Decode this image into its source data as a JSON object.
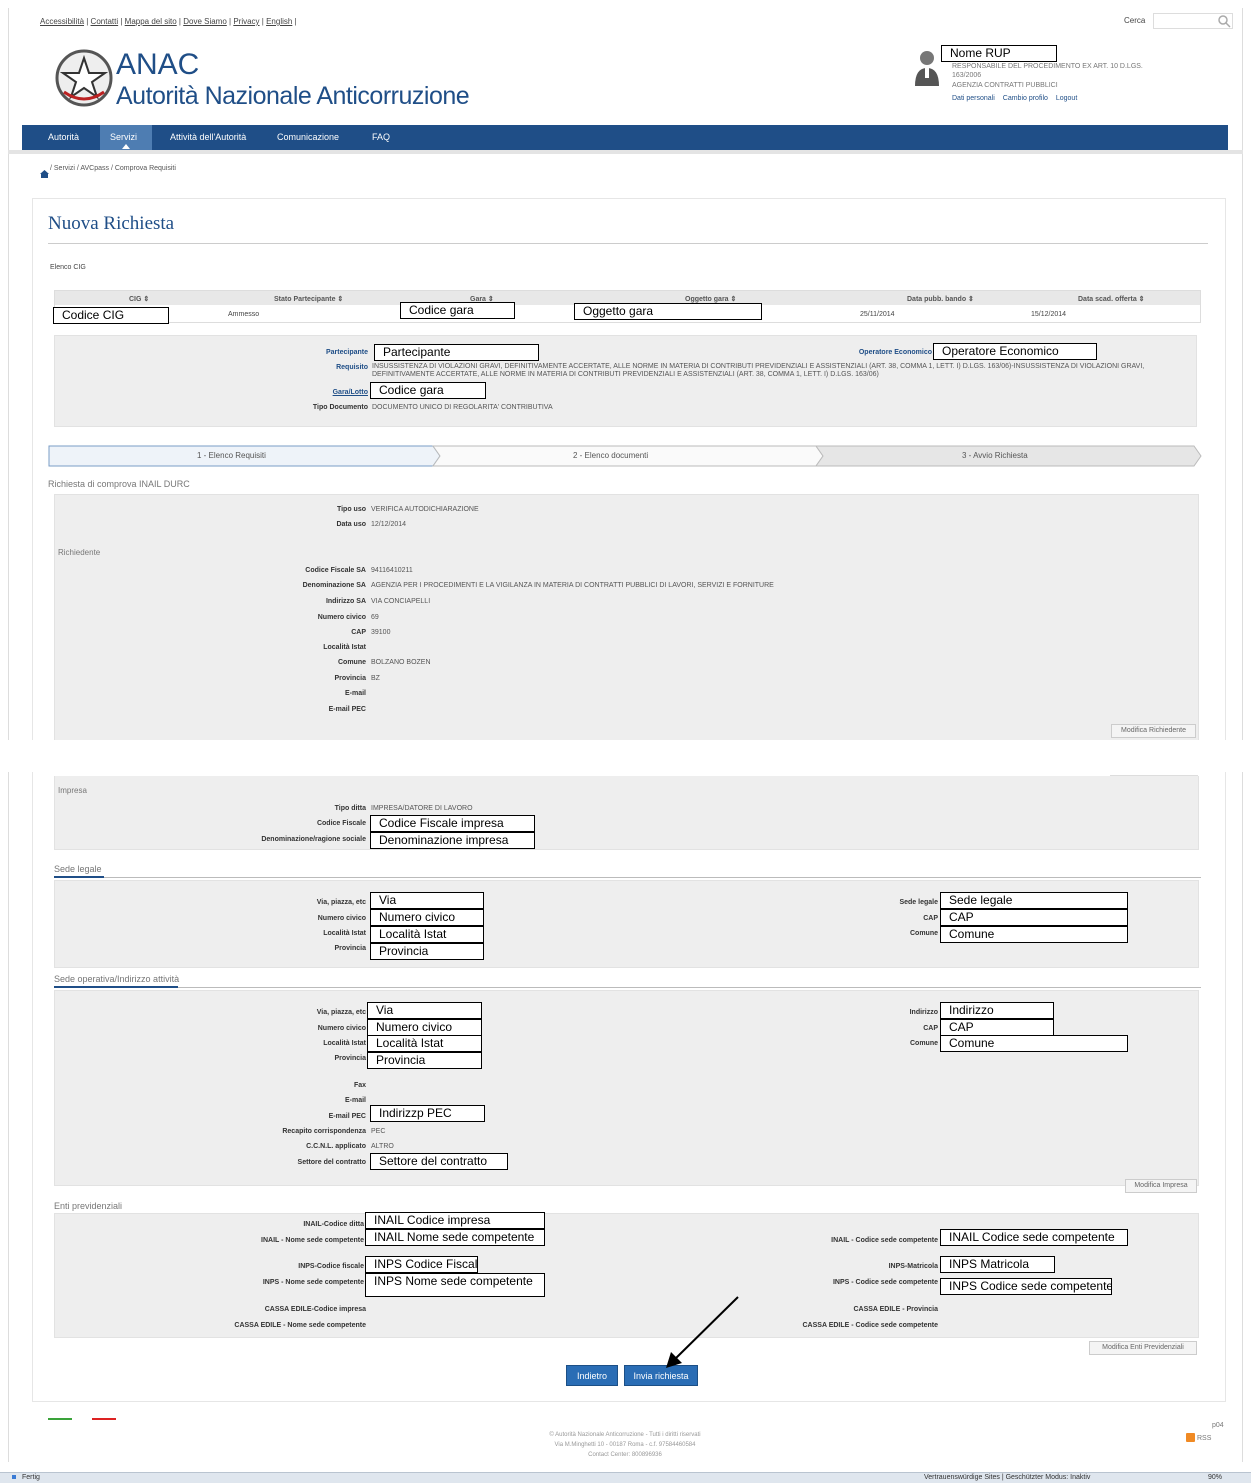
{
  "topnav": {
    "links": [
      "Accessibilità",
      "Contatti",
      "Mappa del sito",
      "Dove Siamo",
      "Privacy",
      "English"
    ],
    "search_label": "Cerca"
  },
  "logo": {
    "short": "ANAC",
    "long": "Autorità Nazionale Anticorruzione"
  },
  "user": {
    "name": "Nome RUP",
    "role": "RESPONSABILE DEL PROCEDIMENTO EX ART. 10 D.LGS. 163/2006",
    "org": "AGENZIA CONTRATTI PUBBLICI",
    "links": [
      "Dati personali",
      "Cambio profilo",
      "Logout"
    ]
  },
  "mainnav": {
    "items": [
      "Autorità",
      "Servizi",
      "Attività dell'Autorità",
      "Comunicazione",
      "FAQ"
    ],
    "active": "Servizi"
  },
  "breadcrumb": "/ Servizi / AVCpass / Comprova Requisiti",
  "page_title": "Nuova Richiesta",
  "cig_list": {
    "label": "Elenco CIG",
    "headers": [
      "CIG ⇕",
      "Stato Partecipante ⇕",
      "Gara ⇕",
      "Oggetto gara ⇕",
      "Data pubb. bando ⇕",
      "Data scad. offerta ⇕"
    ],
    "row": {
      "cig": "Codice CIG",
      "stato": "Ammesso",
      "gara": "Codice gara",
      "oggetto": "Oggetto gara",
      "data_pubb": "25/11/2014",
      "data_scad": "15/12/2014"
    }
  },
  "details": {
    "partecipante_label": "Partecipante",
    "partecipante": "Partecipante",
    "operatore_label": "Operatore Economico",
    "operatore": "Operatore Economico",
    "requisito_label": "Requisito",
    "requisito": "INSUSSISTENZA DI VIOLAZIONI GRAVI, DEFINITIVAMENTE ACCERTATE, ALLE NORME IN MATERIA DI CONTRIBUTI PREVIDENZIALI E ASSISTENZIALI (ART. 38, COMMA 1, LETT. I) D.LGS. 163/06)-INSUSSISTENZA DI VIOLAZIONI GRAVI, DEFINITIVAMENTE ACCERTATE, ALLE NORME IN MATERIA DI CONTRIBUTI PREVIDENZIALI E ASSISTENZIALI (ART. 38, COMMA 1, LETT. I) D.LGS. 163/06)",
    "gara_label": "Gara/Lotto",
    "gara": "Codice gara",
    "tipo_doc_label": "Tipo Documento",
    "tipo_doc": "DOCUMENTO UNICO DI REGOLARITA' CONTRIBUTIVA"
  },
  "steps": [
    "1 - Elenco Requisiti",
    "2 - Elenco documenti",
    "3 - Avvio Richiesta"
  ],
  "request": {
    "title": "Richiesta di comprova INAIL DURC",
    "tipo_uso_label": "Tipo uso",
    "tipo_uso": "VERIFICA AUTODICHIARAZIONE",
    "data_uso_label": "Data uso",
    "data_uso": "12/12/2014"
  },
  "richiedente": {
    "title": "Richiedente",
    "fields": [
      {
        "label": "Codice Fiscale SA",
        "value": "94116410211"
      },
      {
        "label": "Denominazione SA",
        "value": "AGENZIA PER I PROCEDIMENTI E LA VIGILANZA IN MATERIA DI CONTRATTI PUBBLICI DI LAVORI, SERVIZI E FORNITURE"
      },
      {
        "label": "Indirizzo SA",
        "value": "VIA CONCIAPELLI"
      },
      {
        "label": "Numero civico",
        "value": "69"
      },
      {
        "label": "CAP",
        "value": "39100"
      },
      {
        "label": "Località Istat",
        "value": ""
      },
      {
        "label": "Comune",
        "value": "BOLZANO BOZEN"
      },
      {
        "label": "Provincia",
        "value": "BZ"
      },
      {
        "label": "E-mail",
        "value": ""
      },
      {
        "label": "E-mail PEC",
        "value": ""
      }
    ],
    "button": "Modifica Richiedente"
  },
  "impresa": {
    "title": "Impresa",
    "tipo_ditta_label": "Tipo ditta",
    "tipo_ditta": "IMPRESA/DATORE DI LAVORO",
    "cf_label": "Codice Fiscale",
    "cf": "Codice Fiscale impresa",
    "denom_label": "Denominazione/ragione sociale",
    "denom": "Denominazione impresa"
  },
  "sede_legale": {
    "title": "Sede legale",
    "via_label": "Via, piazza, etc",
    "via": "Via",
    "civico_label": "Numero civico",
    "civico": "Numero civico",
    "istat_label": "Località Istat",
    "istat": "Località Istat",
    "prov_label": "Provincia",
    "prov": "Provincia",
    "sede_label": "Sede legale",
    "sede": "Sede legale",
    "cap_label": "CAP",
    "cap": "CAP",
    "comune_label": "Comune",
    "comune": "Comune"
  },
  "sede_operativa": {
    "title": "Sede operativa/Indirizzo attività",
    "via_label": "Via, piazza, etc",
    "via": "Via",
    "civico_label": "Numero civico",
    "civico": "Numero civico",
    "istat_label": "Località Istat",
    "istat": "Località Istat",
    "prov_label": "Provincia",
    "prov": "Provincia",
    "ind_label": "Indirizzo",
    "ind": "Indirizzo",
    "cap_label": "CAP",
    "cap": "CAP",
    "comune_label": "Comune",
    "comune": "Comune",
    "fax_label": "Fax",
    "email_label": "E-mail",
    "pec_label": "E-mail PEC",
    "pec": "Indirizzp PEC",
    "recapito_label": "Recapito corrispondenza",
    "recapito": "PEC",
    "ccnl_label": "C.C.N.L. applicato",
    "ccnl": "ALTRO",
    "settore_label": "Settore del contratto",
    "settore": "Settore del contratto",
    "button": "Modifica Impresa"
  },
  "enti": {
    "title": "Enti previdenziali",
    "inail_cod_label": "INAIL-Codice ditta",
    "inail_cod": "INAIL Codice impresa",
    "inail_nome_label": "INAIL - Nome sede competente",
    "inail_nome": "INAIL Nome sede competente",
    "inail_sede_label": "INAIL - Codice sede competente",
    "inail_sede": "INAIL Codice sede competente",
    "inps_cf_label": "INPS-Codice fiscale",
    "inps_cf": "INPS Codice Fiscale",
    "inps_mat_label": "INPS-Matricola",
    "inps_mat": "INPS Matricola",
    "inps_nome_label": "INPS - Nome sede competente",
    "inps_nome": "INPS Nome sede competente",
    "inps_sede_label": "INPS - Codice sede competente",
    "inps_sede": "INPS Codice sede competente",
    "cassa_cod_label": "CASSA EDILE-Codice impresa",
    "cassa_prov_label": "CASSA EDILE - Provincia",
    "cassa_nome_label": "CASSA EDILE - Nome sede competente",
    "cassa_sede_label": "CASSA EDILE - Codice sede competente",
    "button": "Modifica Enti Previdenziali"
  },
  "actions": {
    "back": "Indietro",
    "send": "Invia richiesta"
  },
  "footer": {
    "line1": "© Autorità Nazionale Anticorruzione - Tutti i diritti riservati",
    "line2": "Via M.Minghetti 10 - 00187 Roma - c.f. 97584460584",
    "line3": "Contact Center: 800896936",
    "code": "p04",
    "rss": "RSS"
  },
  "statusbar": {
    "left": "Fertig",
    "center": "Vertrauenswürdige Sites | Geschützter Modus: Inaktiv",
    "zoom": "90%"
  },
  "colors": {
    "nav": "#1f4e87",
    "button": "#2a6db5",
    "title": "#1f4e87",
    "panel": "#eeeeee"
  }
}
